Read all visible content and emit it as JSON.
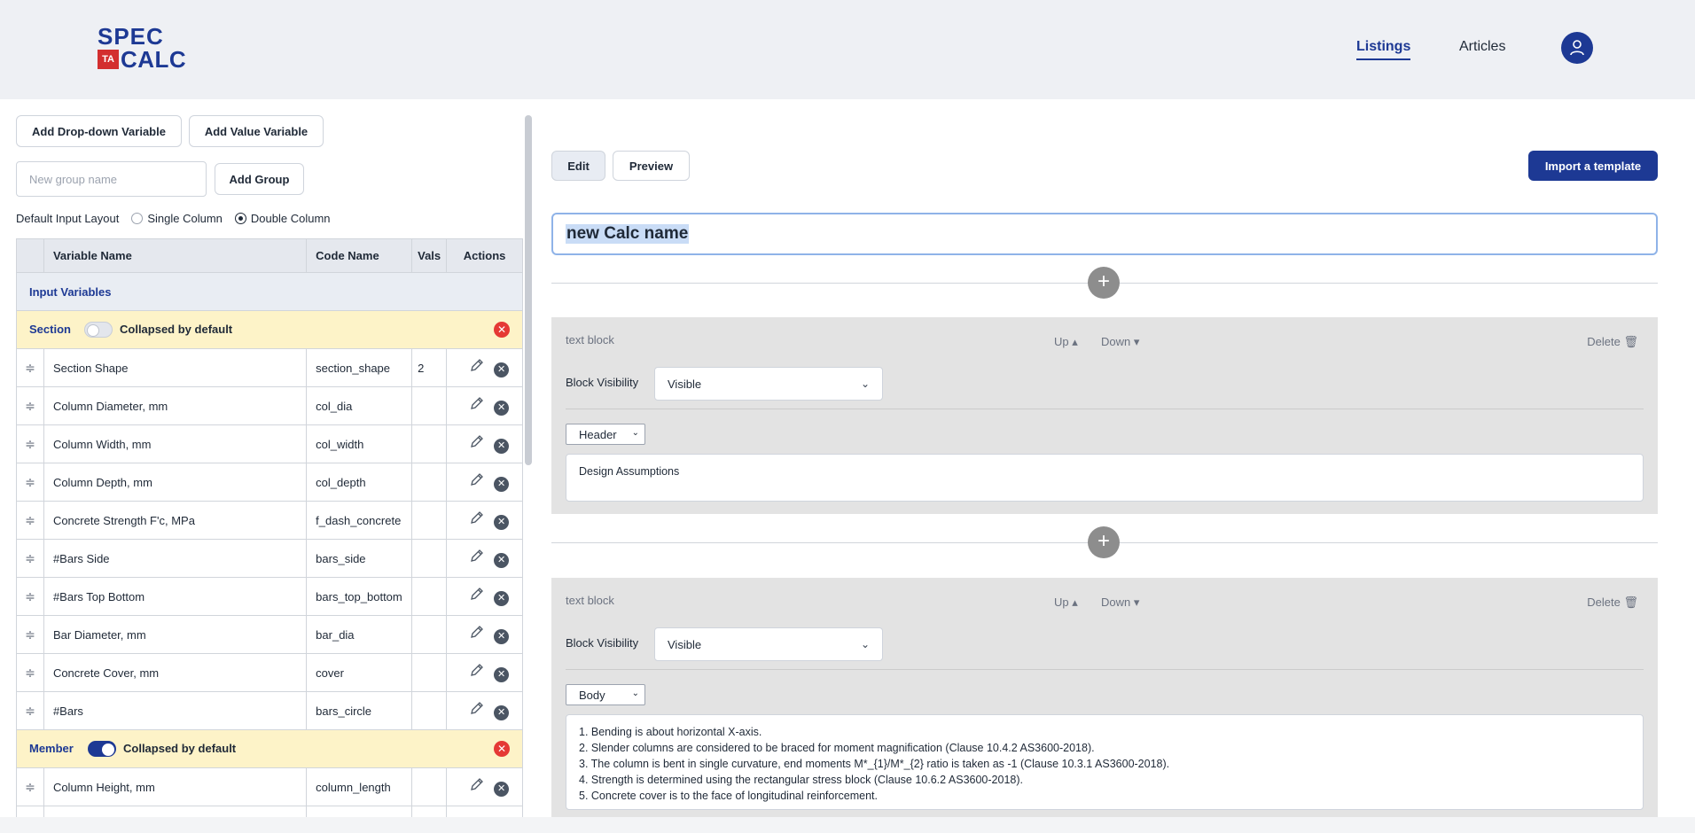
{
  "brand": {
    "logo_top": "SPEC",
    "logo_badge": "TA",
    "logo_bottom": "CALC"
  },
  "nav": {
    "listings": "Listings",
    "articles": "Articles"
  },
  "left": {
    "add_dropdown_label": "Add Drop-down Variable",
    "add_value_label": "Add Value Variable",
    "group_placeholder": "New group name",
    "add_group_label": "Add Group",
    "layout_label": "Default Input Layout",
    "layout_options": [
      "Single Column",
      "Double Column"
    ],
    "layout_selected": "Double Column",
    "columns": [
      "Variable Name",
      "Code Name",
      "Vals",
      "Actions"
    ],
    "group_title": "Input Variables",
    "collapsed_label": "Collapsed by default",
    "sections": [
      {
        "title": "Section",
        "collapsed": false,
        "rows": [
          {
            "name": "Section Shape",
            "code": "section_shape",
            "vals": "2"
          },
          {
            "name": "Column Diameter, mm",
            "code": "col_dia",
            "vals": ""
          },
          {
            "name": "Column Width, mm",
            "code": "col_width",
            "vals": ""
          },
          {
            "name": "Column Depth, mm",
            "code": "col_depth",
            "vals": ""
          },
          {
            "name": "Concrete Strength F'c, MPa",
            "code": "f_dash_concrete",
            "vals": ""
          },
          {
            "name": "#Bars Side",
            "code": "bars_side",
            "vals": ""
          },
          {
            "name": "#Bars Top Bottom",
            "code": "bars_top_bottom",
            "vals": ""
          },
          {
            "name": "Bar Diameter, mm",
            "code": "bar_dia",
            "vals": ""
          },
          {
            "name": "Concrete Cover, mm",
            "code": "cover",
            "vals": ""
          },
          {
            "name": "#Bars",
            "code": "bars_circle",
            "vals": ""
          }
        ]
      },
      {
        "title": "Member",
        "collapsed": true,
        "rows": [
          {
            "name": "Column Height, mm",
            "code": "column_length",
            "vals": ""
          }
        ]
      }
    ]
  },
  "right": {
    "edit_label": "Edit",
    "preview_label": "Preview",
    "import_label": "Import a template",
    "calc_name": "new Calc name",
    "up_label": "Up",
    "down_label": "Down",
    "delete_label": "Delete",
    "visibility_label": "Block Visibility",
    "blocks": [
      {
        "type": "text block",
        "visibility": "Visible",
        "style": "Header",
        "text": "Design Assumptions"
      },
      {
        "type": "text block",
        "visibility": "Visible",
        "style": "Body",
        "lines": [
          "1. Bending is about horizontal X-axis.",
          "2. Slender columns are considered to be braced for moment magnification (Clause 10.4.2 AS3600-2018).",
          "3. The column is bent in single curvature, end moments M*_{1}/M*_{2} ratio is taken as -1 (Clause 10.3.1 AS3600-2018).",
          "4. Strength is determined using the rectangular stress block (Clause 10.6.2 AS3600-2018).",
          "5. Concrete cover is to the face of longitudinal reinforcement."
        ]
      }
    ]
  },
  "colors": {
    "brand": "#1d3994",
    "danger": "#e53935",
    "section_bg": "#fdf3c8"
  }
}
